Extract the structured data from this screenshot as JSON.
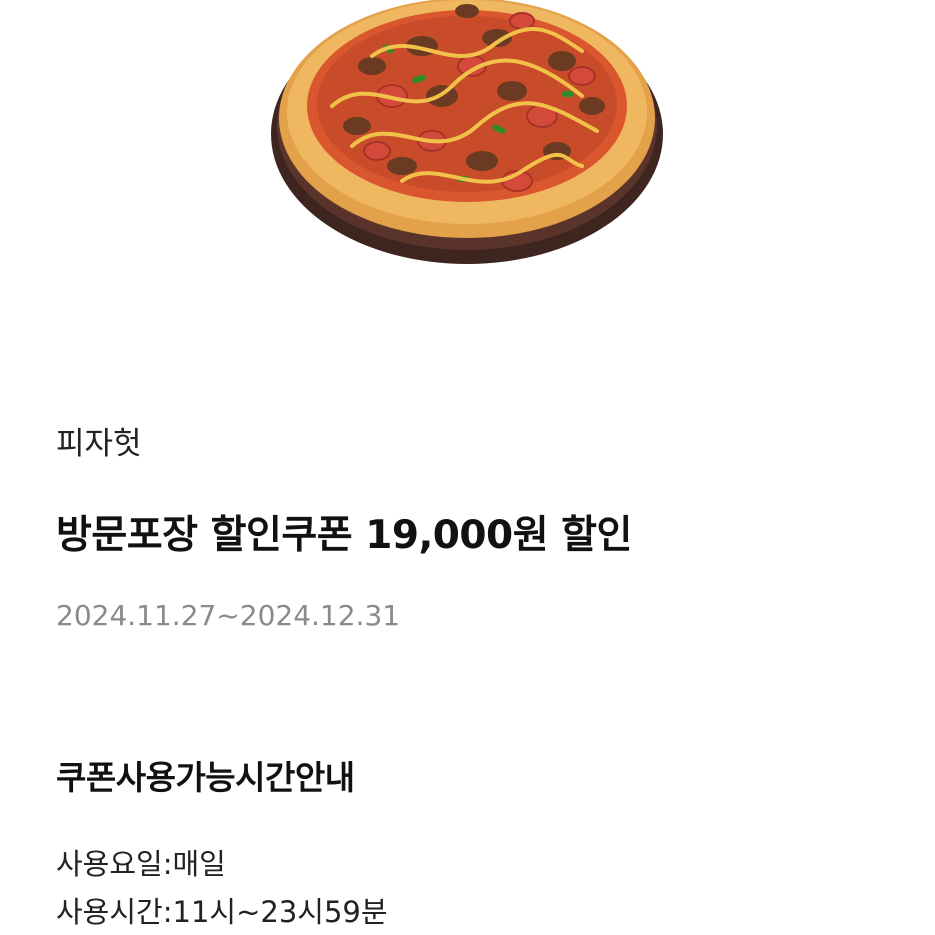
{
  "product_image": {
    "icon": "pizza-image",
    "colors": {
      "board": "#3e2520",
      "crust": "#e6a84f",
      "sauce": "#d9562e",
      "drizzle": "#f2c14a",
      "meat": "#6b3a22",
      "sausage": "#d44a3a",
      "pepper": "#2f8a2a"
    }
  },
  "brand": "피자헛",
  "coupon": {
    "title": "방문포장 할인쿠폰 19,000원 할인",
    "period": "2024.11.27~2024.12.31"
  },
  "usage_info": {
    "title": "쿠폰사용가능시간안내",
    "day": "사용요일:매일",
    "time": "사용시간:11시~23시59분"
  }
}
